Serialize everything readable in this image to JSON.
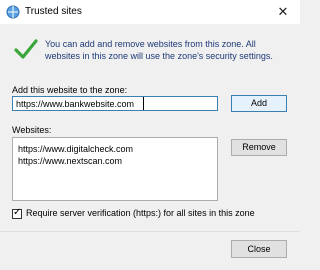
{
  "window": {
    "title": "Trusted sites",
    "close_glyph": "✕"
  },
  "info": {
    "text": "You can add and remove websites from this zone. All websites in this zone will use the zone's security settings."
  },
  "add": {
    "label": "Add this website to the zone:",
    "value": "https://www.bankwebsite.com",
    "button": "Add"
  },
  "websites": {
    "label": "Websites:",
    "items": [
      "https://www.digitalcheck.com",
      "https://www.nextscan.com"
    ],
    "remove_button": "Remove"
  },
  "verification": {
    "checked": true,
    "check_glyph": "✓",
    "label": "Require server verification (https:) for all sites in this zone"
  },
  "footer": {
    "close_button": "Close"
  },
  "colors": {
    "accent": "#3c7fb1",
    "check_green": "#3aa63a",
    "info_text": "#1e3a78"
  }
}
